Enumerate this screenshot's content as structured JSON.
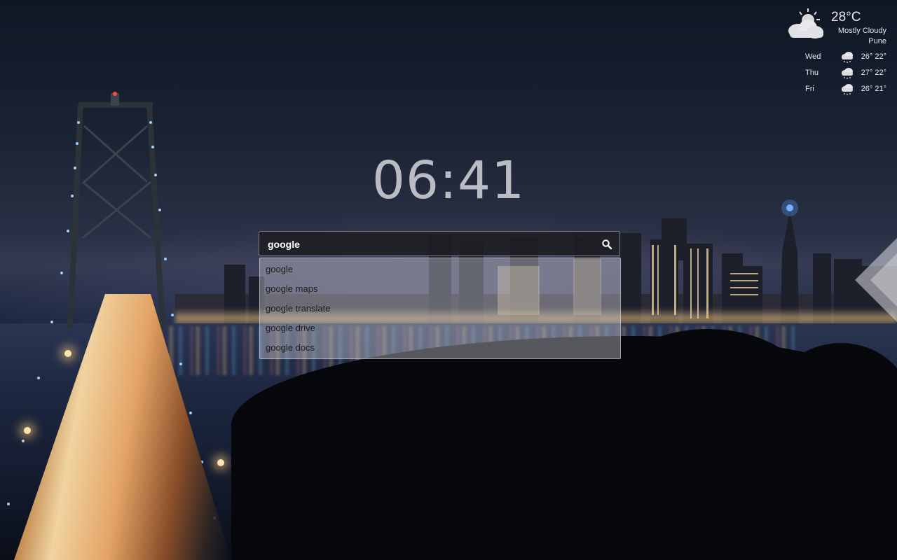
{
  "clock": {
    "time": "06:41"
  },
  "search": {
    "query": "google",
    "icon": "search-icon",
    "suggestions": [
      "google",
      "google maps",
      "google translate",
      "google drive",
      "google docs"
    ]
  },
  "weather": {
    "temperature": "28°C",
    "condition": "Mostly Cloudy",
    "city": "Pune",
    "icon": "partly-cloudy-icon",
    "forecast": [
      {
        "day": "Wed",
        "high": "26°",
        "low": "22°",
        "icon": "rain-cloud-icon"
      },
      {
        "day": "Thu",
        "high": "27°",
        "low": "22°",
        "icon": "rain-cloud-icon"
      },
      {
        "day": "Fri",
        "high": "26°",
        "low": "21°",
        "icon": "rain-cloud-icon"
      }
    ]
  },
  "colors": {
    "clock_text": "#dcdce1",
    "search_bg": "#1e1e22",
    "suggestion_text": "#1c1c1c",
    "weather_text": "#e6e6ea"
  }
}
